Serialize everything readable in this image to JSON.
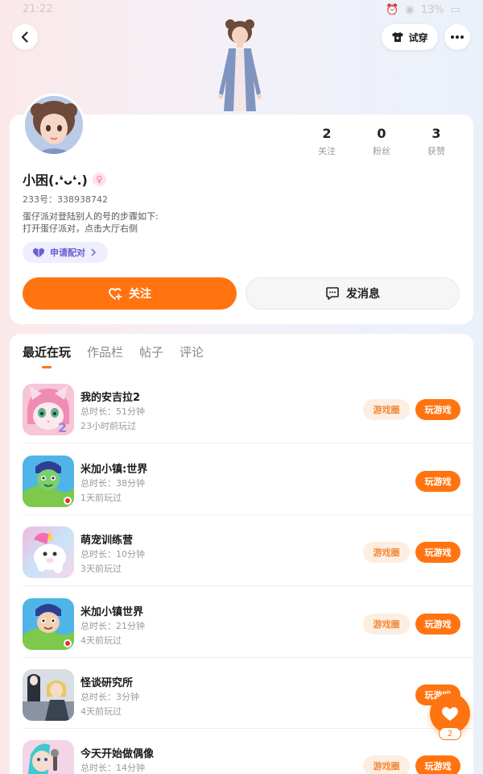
{
  "status_bar": {
    "time": "21:22",
    "battery": "13%"
  },
  "header": {
    "try_on_label": "试穿"
  },
  "profile": {
    "name": "小困(.❛ᴗ❛.)",
    "gender_symbol": "♀",
    "uid": "233号：338938742",
    "bio_line1": "蛋仔派对登陆别人的号的步骤如下:",
    "bio_line2": "打开蛋仔派对，点击大厅右侧",
    "pair_label": "申请配对",
    "stats": [
      {
        "num": "2",
        "label": "关注"
      },
      {
        "num": "0",
        "label": "粉丝"
      },
      {
        "num": "3",
        "label": "获赞"
      }
    ],
    "follow_label": "关注",
    "message_label": "发消息"
  },
  "tabs": [
    "最近在玩",
    "作品栏",
    "帖子",
    "评论"
  ],
  "games": [
    {
      "title": "我的安吉拉2",
      "duration": "总时长：51分钟",
      "last": "23小时前玩过",
      "circle": "游戏圈",
      "play": "玩游戏",
      "icon": "angela-game-icon"
    },
    {
      "title": "米加小镇:世界",
      "duration": "总时长：38分钟",
      "last": "1天前玩过",
      "circle": "",
      "play": "玩游戏",
      "icon": "toca-world-icon"
    },
    {
      "title": "萌宠训练营",
      "duration": "总时长：10分钟",
      "last": "3天前玩过",
      "circle": "游戏圈",
      "play": "玩游戏",
      "icon": "unicorn-pet-icon"
    },
    {
      "title": "米加小镇世界",
      "duration": "总时长：21分钟",
      "last": "4天前玩过",
      "circle": "游戏圈",
      "play": "玩游戏",
      "icon": "toca-world-icon"
    },
    {
      "title": "怪谈研究所",
      "duration": "总时长：3分钟",
      "last": "4天前玩过",
      "circle": "",
      "play": "玩游戏",
      "icon": "ghost-story-icon"
    },
    {
      "title": "今天开始做偶像",
      "duration": "总时长：14分钟",
      "last": "",
      "circle": "游戏圈",
      "play": "玩游戏",
      "icon": "idol-game-icon"
    }
  ],
  "fab": {
    "count": "2"
  },
  "colors": {
    "accent": "#ff7410",
    "pair_text": "#6b5fd0",
    "circle_bg": "#fdeee2"
  }
}
